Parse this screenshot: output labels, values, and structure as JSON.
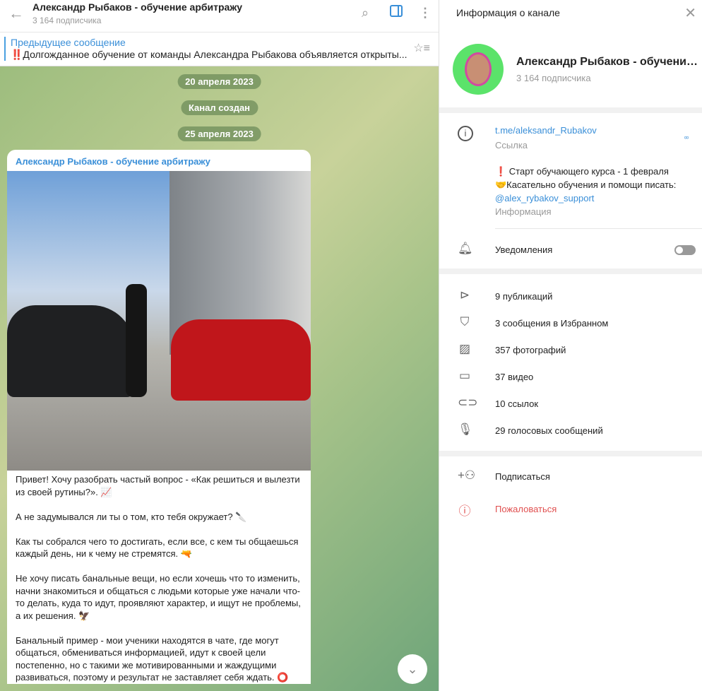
{
  "chat": {
    "title": "Александр Рыбаков - обучение арбитражу",
    "subtitle": "3 164 подписчика",
    "pinned": {
      "label": "Предыдущее сообщение",
      "text": "‼️Долгожданное обучение от команды Александра Рыбакова объявляется открыты..."
    },
    "dates": [
      "20 апреля 2023",
      "Канал создан",
      "25 апреля 2023"
    ],
    "message": {
      "author": "Александр Рыбаков - обучение арбитражу",
      "paragraphs": [
        "Привет! Хочу разобрать частый вопрос - «Как решиться и вылезти из своей рутины?». 📈",
        "А не задумывался ли ты о том, кто тебя окружает? 🔪",
        "Как ты собрался чего то достигать, если все, с кем ты общаешься каждый день, ни к чему не стремятся. 🔫",
        "Не хочу писать банальные вещи, но если хочешь что то изменить, начни знакомиться и общаться с людьми которые уже начали что-то делать, куда то идут, проявляют характер, и ищут не проблемы, а их решения. 🦅",
        "Банальный пример - мои ученики находятся в чате, где могут общаться, обмениваться информацией, идут к своей цели постепенно, но с такими же мотивированными и жаждущими развиваться, поэтому и результат не заставляет себя ждать. ⭕"
      ]
    }
  },
  "info": {
    "header": "Информация о канале",
    "name": "Александр Рыбаков - обучение арбитражу",
    "subscribers": "3 164 подписчика",
    "link": "t.me/aleksandr_Rubakov",
    "link_label": "Ссылка",
    "desc_line1": "❗ Старт обучающего курса - 1 февраля",
    "desc_line2": "🤝Касательно обучения и помощи писать:",
    "desc_handle": "@alex_rybakov_support",
    "desc_label": "Информация",
    "notifications": "Уведомления",
    "notifications_on": false,
    "stats": [
      "9 публикаций",
      "3 сообщения в Избранном",
      "357 фотографий",
      "37 видео",
      "10 ссылок",
      "29 голосовых сообщений"
    ],
    "subscribe": "Подписаться",
    "report": "Пожаловаться"
  },
  "colors": {
    "accent": "#3a8fd8",
    "danger": "#e05050"
  }
}
